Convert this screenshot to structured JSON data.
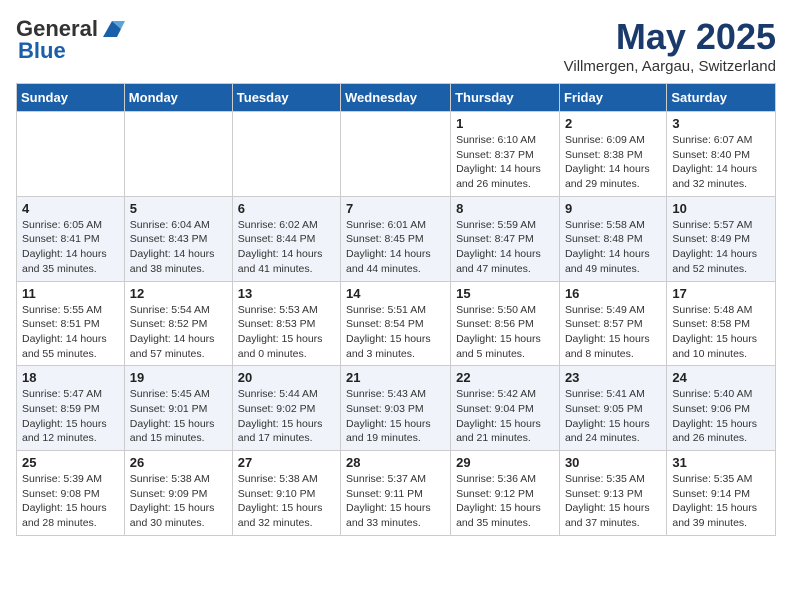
{
  "logo": {
    "general": "General",
    "blue": "Blue"
  },
  "title": "May 2025",
  "location": "Villmergen, Aargau, Switzerland",
  "days_of_week": [
    "Sunday",
    "Monday",
    "Tuesday",
    "Wednesday",
    "Thursday",
    "Friday",
    "Saturday"
  ],
  "weeks": [
    [
      {
        "day": "",
        "info": ""
      },
      {
        "day": "",
        "info": ""
      },
      {
        "day": "",
        "info": ""
      },
      {
        "day": "",
        "info": ""
      },
      {
        "day": "1",
        "info": "Sunrise: 6:10 AM\nSunset: 8:37 PM\nDaylight: 14 hours and 26 minutes."
      },
      {
        "day": "2",
        "info": "Sunrise: 6:09 AM\nSunset: 8:38 PM\nDaylight: 14 hours and 29 minutes."
      },
      {
        "day": "3",
        "info": "Sunrise: 6:07 AM\nSunset: 8:40 PM\nDaylight: 14 hours and 32 minutes."
      }
    ],
    [
      {
        "day": "4",
        "info": "Sunrise: 6:05 AM\nSunset: 8:41 PM\nDaylight: 14 hours and 35 minutes."
      },
      {
        "day": "5",
        "info": "Sunrise: 6:04 AM\nSunset: 8:43 PM\nDaylight: 14 hours and 38 minutes."
      },
      {
        "day": "6",
        "info": "Sunrise: 6:02 AM\nSunset: 8:44 PM\nDaylight: 14 hours and 41 minutes."
      },
      {
        "day": "7",
        "info": "Sunrise: 6:01 AM\nSunset: 8:45 PM\nDaylight: 14 hours and 44 minutes."
      },
      {
        "day": "8",
        "info": "Sunrise: 5:59 AM\nSunset: 8:47 PM\nDaylight: 14 hours and 47 minutes."
      },
      {
        "day": "9",
        "info": "Sunrise: 5:58 AM\nSunset: 8:48 PM\nDaylight: 14 hours and 49 minutes."
      },
      {
        "day": "10",
        "info": "Sunrise: 5:57 AM\nSunset: 8:49 PM\nDaylight: 14 hours and 52 minutes."
      }
    ],
    [
      {
        "day": "11",
        "info": "Sunrise: 5:55 AM\nSunset: 8:51 PM\nDaylight: 14 hours and 55 minutes."
      },
      {
        "day": "12",
        "info": "Sunrise: 5:54 AM\nSunset: 8:52 PM\nDaylight: 14 hours and 57 minutes."
      },
      {
        "day": "13",
        "info": "Sunrise: 5:53 AM\nSunset: 8:53 PM\nDaylight: 15 hours and 0 minutes."
      },
      {
        "day": "14",
        "info": "Sunrise: 5:51 AM\nSunset: 8:54 PM\nDaylight: 15 hours and 3 minutes."
      },
      {
        "day": "15",
        "info": "Sunrise: 5:50 AM\nSunset: 8:56 PM\nDaylight: 15 hours and 5 minutes."
      },
      {
        "day": "16",
        "info": "Sunrise: 5:49 AM\nSunset: 8:57 PM\nDaylight: 15 hours and 8 minutes."
      },
      {
        "day": "17",
        "info": "Sunrise: 5:48 AM\nSunset: 8:58 PM\nDaylight: 15 hours and 10 minutes."
      }
    ],
    [
      {
        "day": "18",
        "info": "Sunrise: 5:47 AM\nSunset: 8:59 PM\nDaylight: 15 hours and 12 minutes."
      },
      {
        "day": "19",
        "info": "Sunrise: 5:45 AM\nSunset: 9:01 PM\nDaylight: 15 hours and 15 minutes."
      },
      {
        "day": "20",
        "info": "Sunrise: 5:44 AM\nSunset: 9:02 PM\nDaylight: 15 hours and 17 minutes."
      },
      {
        "day": "21",
        "info": "Sunrise: 5:43 AM\nSunset: 9:03 PM\nDaylight: 15 hours and 19 minutes."
      },
      {
        "day": "22",
        "info": "Sunrise: 5:42 AM\nSunset: 9:04 PM\nDaylight: 15 hours and 21 minutes."
      },
      {
        "day": "23",
        "info": "Sunrise: 5:41 AM\nSunset: 9:05 PM\nDaylight: 15 hours and 24 minutes."
      },
      {
        "day": "24",
        "info": "Sunrise: 5:40 AM\nSunset: 9:06 PM\nDaylight: 15 hours and 26 minutes."
      }
    ],
    [
      {
        "day": "25",
        "info": "Sunrise: 5:39 AM\nSunset: 9:08 PM\nDaylight: 15 hours and 28 minutes."
      },
      {
        "day": "26",
        "info": "Sunrise: 5:38 AM\nSunset: 9:09 PM\nDaylight: 15 hours and 30 minutes."
      },
      {
        "day": "27",
        "info": "Sunrise: 5:38 AM\nSunset: 9:10 PM\nDaylight: 15 hours and 32 minutes."
      },
      {
        "day": "28",
        "info": "Sunrise: 5:37 AM\nSunset: 9:11 PM\nDaylight: 15 hours and 33 minutes."
      },
      {
        "day": "29",
        "info": "Sunrise: 5:36 AM\nSunset: 9:12 PM\nDaylight: 15 hours and 35 minutes."
      },
      {
        "day": "30",
        "info": "Sunrise: 5:35 AM\nSunset: 9:13 PM\nDaylight: 15 hours and 37 minutes."
      },
      {
        "day": "31",
        "info": "Sunrise: 5:35 AM\nSunset: 9:14 PM\nDaylight: 15 hours and 39 minutes."
      }
    ]
  ]
}
